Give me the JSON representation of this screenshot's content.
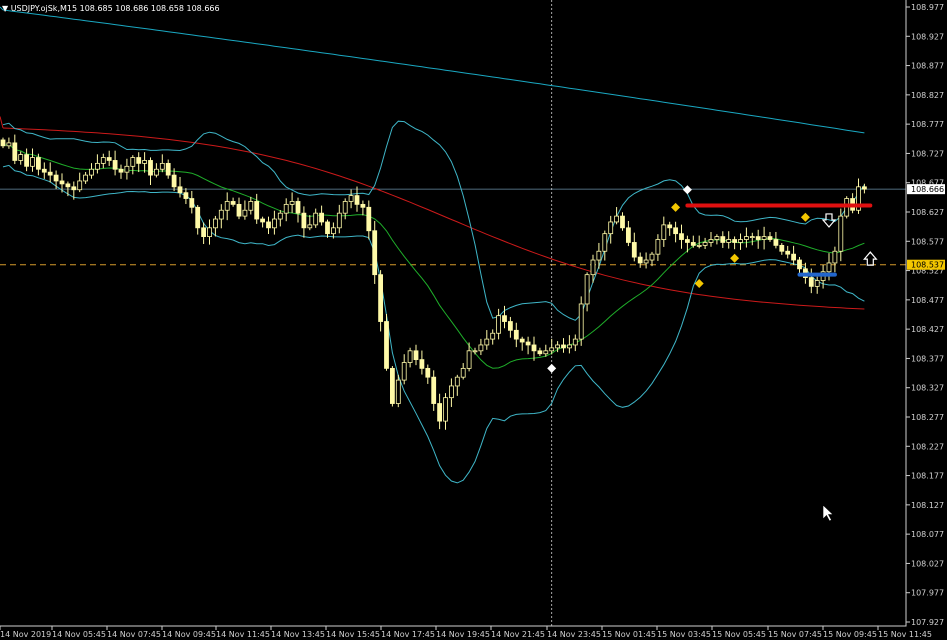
{
  "header": {
    "menu_icon": "triangle-down-icon",
    "symbol": "USDJPY.ojSk,M15",
    "ohlc": "108.685 108.686 108.658 108.666"
  },
  "colors": {
    "background": "#000000",
    "candle_up": "#000000",
    "candle_down": "#fffaa8",
    "candle_outline": "#fffaa8",
    "bollinger": "#3fb6c8",
    "ma_green": "#1fae2a",
    "ma_red": "#cc1a1a",
    "ma_cyan": "#1aa8c2",
    "bid_line": "#6b8fa8",
    "level_line": "#d49a2a",
    "current_label_bg": "#ffffff",
    "level_label_bg": "#f3c700",
    "marker_yellow": "#f3c700",
    "marker_white": "#ffffff",
    "resistance": "#e01010",
    "support": "#2266cc"
  },
  "chart_data": {
    "type": "candlestick",
    "y_ticks": [
      "108.977",
      "108.927",
      "108.877",
      "108.827",
      "108.777",
      "108.727",
      "108.677",
      "108.627",
      "108.577",
      "108.527",
      "108.477",
      "108.427",
      "108.377",
      "108.327",
      "108.277",
      "108.227",
      "108.177",
      "108.127",
      "108.077",
      "108.027",
      "107.977",
      "107.927"
    ],
    "ylim": [
      107.927,
      108.977
    ],
    "x_labels": [
      "14 Nov 2019",
      "14 Nov 05:45",
      "14 Nov 07:45",
      "14 Nov 09:45",
      "14 Nov 11:45",
      "14 Nov 13:45",
      "14 Nov 15:45",
      "14 Nov 17:45",
      "14 Nov 19:45",
      "14 Nov 21:45",
      "14 Nov 23:45",
      "15 Nov 01:45",
      "15 Nov 03:45",
      "15 Nov 05:45",
      "15 Nov 07:45",
      "15 Nov 09:45",
      "15 Nov 11:45"
    ],
    "current_price": "108.666",
    "level_price": "108.537",
    "crosshair_index": 93,
    "close": [
      108.74,
      108.745,
      108.715,
      108.725,
      108.705,
      108.72,
      108.7,
      108.695,
      108.69,
      108.68,
      108.675,
      108.67,
      108.665,
      108.68,
      108.69,
      108.7,
      108.71,
      108.72,
      108.715,
      108.7,
      108.695,
      108.705,
      108.72,
      108.71,
      108.715,
      108.69,
      108.7,
      108.71,
      108.69,
      108.67,
      108.66,
      108.65,
      108.635,
      108.6,
      108.585,
      108.6,
      108.615,
      108.63,
      108.645,
      108.64,
      108.62,
      108.63,
      108.645,
      108.615,
      108.61,
      108.6,
      108.615,
      108.625,
      108.64,
      108.645,
      108.625,
      108.6,
      108.605,
      108.625,
      108.61,
      108.59,
      108.6,
      108.625,
      108.645,
      108.655,
      108.64,
      108.635,
      108.595,
      108.52,
      108.44,
      108.36,
      108.3,
      108.34,
      108.37,
      108.39,
      108.375,
      108.36,
      108.345,
      108.3,
      108.27,
      108.31,
      108.33,
      108.345,
      108.36,
      108.39,
      108.39,
      108.4,
      108.41,
      108.42,
      108.45,
      108.44,
      108.425,
      108.41,
      108.405,
      108.4,
      108.39,
      108.385,
      108.39,
      108.395,
      108.4,
      108.395,
      108.4,
      108.41,
      108.47,
      108.52,
      108.545,
      108.56,
      108.59,
      108.61,
      108.62,
      108.6,
      108.575,
      108.55,
      108.54,
      108.545,
      108.555,
      108.58,
      108.605,
      108.6,
      108.59,
      108.58,
      108.575,
      108.57,
      108.57,
      108.575,
      108.58,
      108.585,
      108.575,
      108.58,
      108.575,
      108.58,
      108.585,
      108.585,
      108.58,
      108.585,
      108.58,
      108.57,
      108.56,
      108.555,
      108.545,
      108.53,
      108.515,
      108.5,
      108.51,
      108.525,
      108.54,
      108.56,
      108.62,
      108.65,
      108.63,
      108.67,
      108.666
    ],
    "markers": [
      {
        "index": 93,
        "price": 108.36,
        "kind": "diamond",
        "color": "white"
      },
      {
        "index": 114,
        "price": 108.635,
        "kind": "diamond",
        "color": "yellow"
      },
      {
        "index": 118,
        "price": 108.505,
        "kind": "diamond",
        "color": "yellow"
      },
      {
        "index": 116,
        "price": 108.665,
        "kind": "diamond",
        "color": "white"
      },
      {
        "index": 124,
        "price": 108.548,
        "kind": "diamond",
        "color": "yellow"
      },
      {
        "index": 136,
        "price": 108.618,
        "kind": "diamond",
        "color": "yellow"
      },
      {
        "index": 140,
        "price": 108.61,
        "kind": "arrow-down",
        "color": "white"
      },
      {
        "index": 147,
        "price": 108.55,
        "kind": "arrow-up",
        "color": "white"
      }
    ],
    "hlines": [
      {
        "start": 116,
        "end": 147,
        "price": 108.638,
        "color": "red"
      },
      {
        "start": 135,
        "end": 141,
        "price": 108.52,
        "color": "blue"
      }
    ]
  }
}
